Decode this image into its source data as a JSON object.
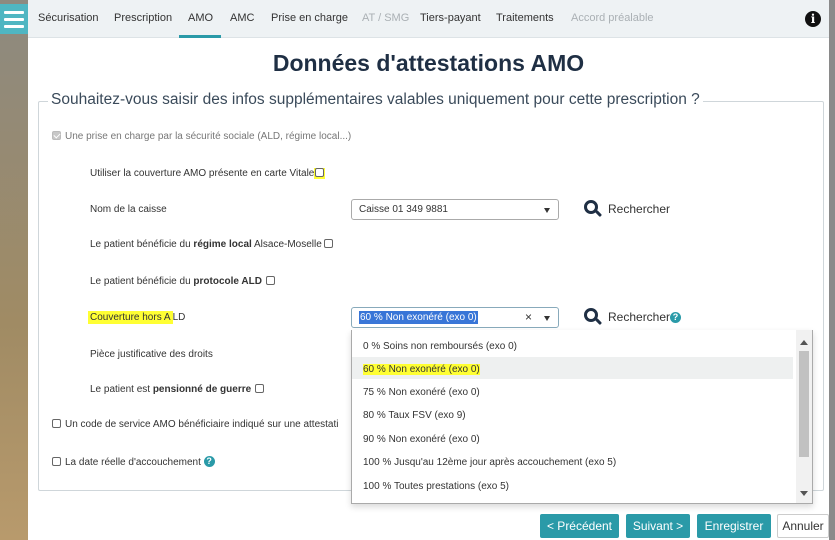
{
  "nav": {
    "tabs": [
      {
        "label": "Sécurisation",
        "disabled": false
      },
      {
        "label": "Prescription",
        "disabled": false
      },
      {
        "label": "AMO",
        "disabled": false,
        "active": true
      },
      {
        "label": "AMC",
        "disabled": false
      },
      {
        "label": "Prise en charge",
        "disabled": false
      },
      {
        "label": "AT / SMG",
        "disabled": true
      },
      {
        "label": "Tiers-payant",
        "disabled": false
      },
      {
        "label": "Traitements",
        "disabled": false
      },
      {
        "label": "Accord préalable",
        "disabled": true
      }
    ]
  },
  "title": "Données d'attestations AMO",
  "legend": "Souhaitez-vous saisir des infos supplémentaires valables uniquement pour cette prescription ?",
  "form": {
    "prise_en_charge": "Une prise en charge par la sécurité sociale (ALD, régime local...)",
    "utiliser_couverture": "Utiliser la couverture AMO présente en carte Vitale",
    "nom_caisse_label": "Nom de la caisse",
    "nom_caisse_value": "Caisse 01 349 9881",
    "rechercher": "Rechercher",
    "regime_local_pre": "Le patient bénéficie du ",
    "regime_local_bold": "régime local",
    "regime_local_post": " Alsace-Moselle",
    "protocole_pre": "Le patient bénéficie du ",
    "protocole_bold": "protocole ALD",
    "couverture_hl": "Couverture hors A",
    "couverture_rest": "LD",
    "couverture_value": "60 % Non exonéré (exo 0)",
    "clear": "×",
    "piece_label": "Pièce justificative des droits",
    "pensionne_pre": "Le patient est ",
    "pensionne_bold": "pensionné de guerre",
    "code_service": "Un code de service AMO bénéficiaire indiqué sur une attestati",
    "date_accouchement": "La date réelle d'accouchement"
  },
  "dropdown_options": [
    "0 % Soins non remboursés (exo 0)",
    "60 % Non exonéré (exo 0)",
    "75 % Non exonéré (exo 0)",
    "80 % Taux FSV (exo 9)",
    "90 % Non exonéré (exo 0)",
    "100 % Jusqu'au 12ème jour après accouchement (exo 5)",
    "100 % Toutes prestations (exo 5)"
  ],
  "buttons": {
    "precedent": "< Précédent",
    "suivant": "Suivant >",
    "enregistrer": "Enregistrer",
    "annuler": "Annuler"
  },
  "colors": {
    "accent": "#2a9aa8",
    "title": "#1f2f44",
    "highlight": "#ffff33",
    "selection": "#3875d7"
  },
  "icons": {
    "menu": "hamburger-icon",
    "info": "info-icon",
    "search": "magnifier-icon",
    "help": "question-circle-icon"
  }
}
